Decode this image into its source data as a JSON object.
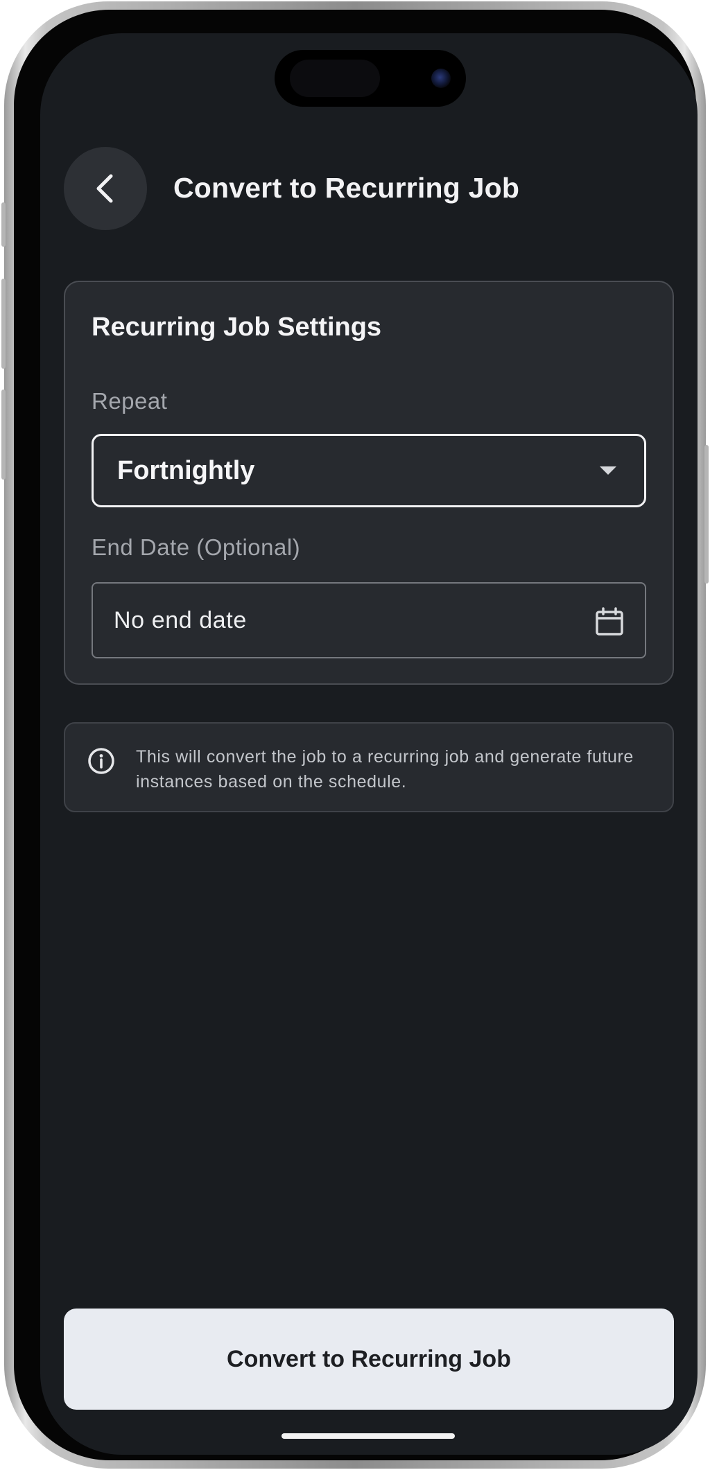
{
  "header": {
    "title": "Convert to Recurring Job",
    "back_icon": "chevron-left-icon"
  },
  "settings_card": {
    "title": "Recurring Job Settings",
    "repeat_label": "Repeat",
    "repeat_value": "Fortnightly",
    "end_date_label": "End Date (Optional)",
    "end_date_value": "No end date",
    "calendar_icon": "calendar-icon"
  },
  "info": {
    "icon": "info-icon",
    "text": "This will convert the job to a recurring job and generate future instances based on the schedule."
  },
  "actions": {
    "convert_label": "Convert to Recurring Job"
  },
  "colors": {
    "background": "#191c20",
    "card": "#272a2f",
    "primary_button": "#e8ebf1"
  }
}
